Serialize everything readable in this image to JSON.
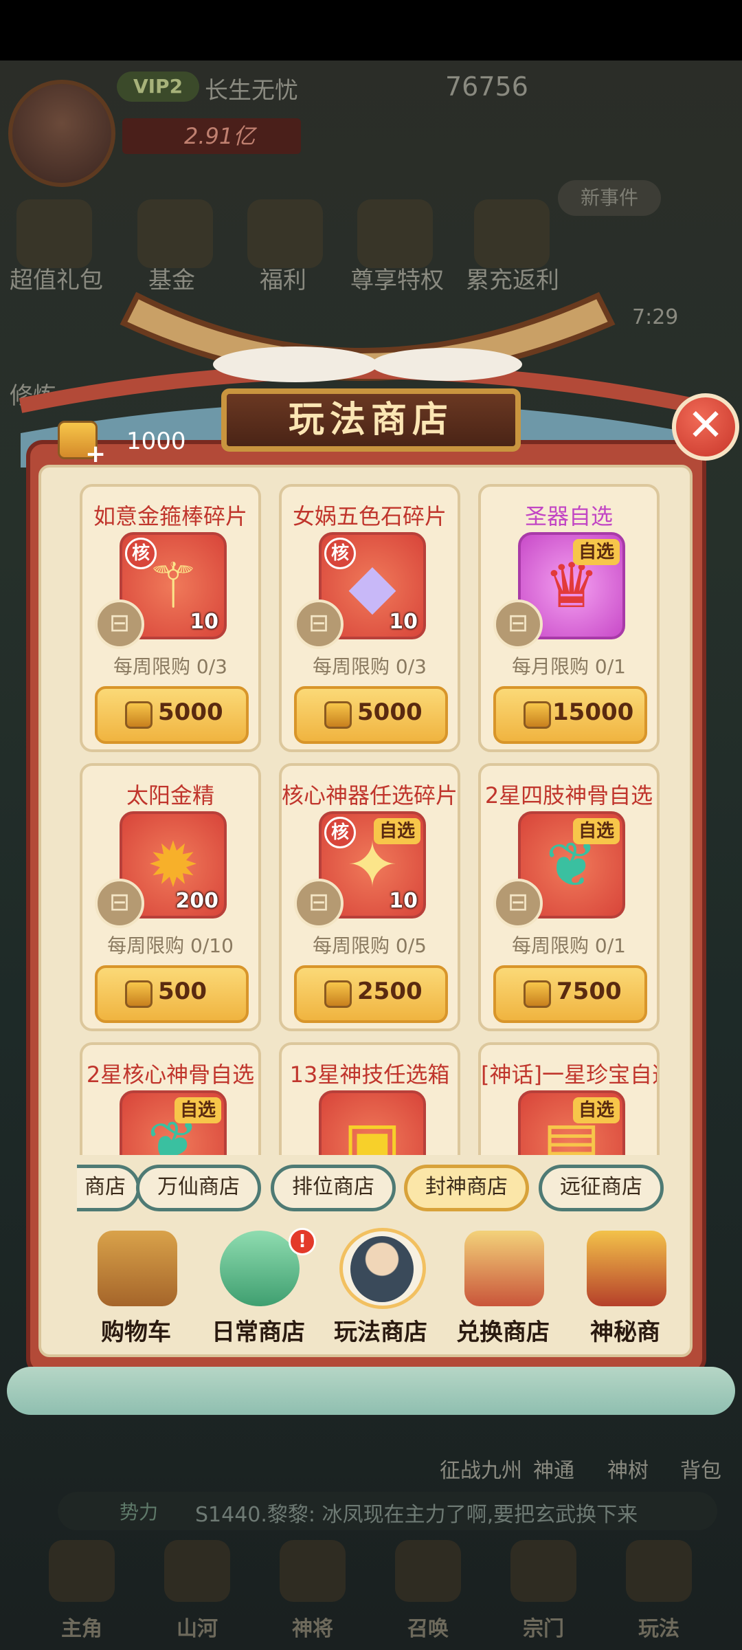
{
  "background": {
    "vip": "VIP2",
    "player_title": "长生无忧",
    "jade": "76756",
    "power": "2.91亿",
    "top_icons": [
      "超值礼包",
      "基金",
      "福利",
      "尊享特权",
      "累充返利"
    ],
    "side_label": "修炼",
    "news": "新事件",
    "timer": "7:29",
    "activities": [
      "征战九州",
      "神通",
      "神树",
      "背包"
    ],
    "chat_channel": "势力",
    "chat_message": "S1440.黎黎:  冰凤现在主力了啊,要把玄武换下来",
    "bottom_nav": [
      "主角",
      "山河",
      "神将",
      "召唤",
      "宗门",
      "玩法"
    ]
  },
  "shop": {
    "title": "玩法商店",
    "currency_amount": "1000",
    "close_icon": "close-icon",
    "items": [
      {
        "name": "如意金箍棒碎片",
        "qty": "10",
        "limit": "每周限购 0/3",
        "price": "5000",
        "core": "核",
        "choose": "",
        "style": "red"
      },
      {
        "name": "女娲五色石碎片",
        "qty": "10",
        "limit": "每周限购 0/3",
        "price": "5000",
        "core": "核",
        "choose": "",
        "style": "red"
      },
      {
        "name": "圣器自选",
        "qty": "",
        "limit": "每月限购 0/1",
        "price": "15000",
        "core": "",
        "choose": "自选",
        "style": "pink"
      },
      {
        "name": "太阳金精",
        "qty": "200",
        "limit": "每周限购 0/10",
        "price": "500",
        "core": "",
        "choose": "",
        "style": "red"
      },
      {
        "name": "核心神器任选碎片",
        "qty": "10",
        "limit": "每周限购 0/5",
        "price": "2500",
        "core": "核",
        "choose": "自选",
        "style": "red"
      },
      {
        "name": "2星四肢神骨自选",
        "qty": "",
        "limit": "每周限购 0/1",
        "price": "7500",
        "core": "",
        "choose": "自选",
        "style": "red"
      },
      {
        "name": "2星核心神骨自选",
        "qty": "",
        "limit": "",
        "price": "",
        "core": "",
        "choose": "自选",
        "style": "red"
      },
      {
        "name": "13星神技任选箱",
        "qty": "",
        "limit": "",
        "price": "",
        "core": "",
        "choose": "",
        "style": "red"
      },
      {
        "name": "[神话]一星珍宝自选",
        "qty": "",
        "limit": "",
        "price": "",
        "core": "",
        "choose": "自选",
        "style": "red"
      }
    ],
    "tabs": [
      {
        "label": "商店",
        "active": false
      },
      {
        "label": "万仙商店",
        "active": false
      },
      {
        "label": "排位商店",
        "active": false
      },
      {
        "label": "封神商店",
        "active": true
      },
      {
        "label": "远征商店",
        "active": false
      }
    ],
    "categories": [
      {
        "label": "购物车",
        "icon": "shopping-basket-icon",
        "active": false,
        "alert": ""
      },
      {
        "label": "日常商店",
        "icon": "jade-pendant-icon",
        "active": false,
        "alert": "!"
      },
      {
        "label": "玩法商店",
        "icon": "scholar-portrait-icon",
        "active": true,
        "alert": ""
      },
      {
        "label": "兑换商店",
        "icon": "pavilion-icon",
        "active": false,
        "alert": ""
      },
      {
        "label": "神秘商",
        "icon": "treasure-chest-icon",
        "active": false,
        "alert": ""
      }
    ]
  }
}
